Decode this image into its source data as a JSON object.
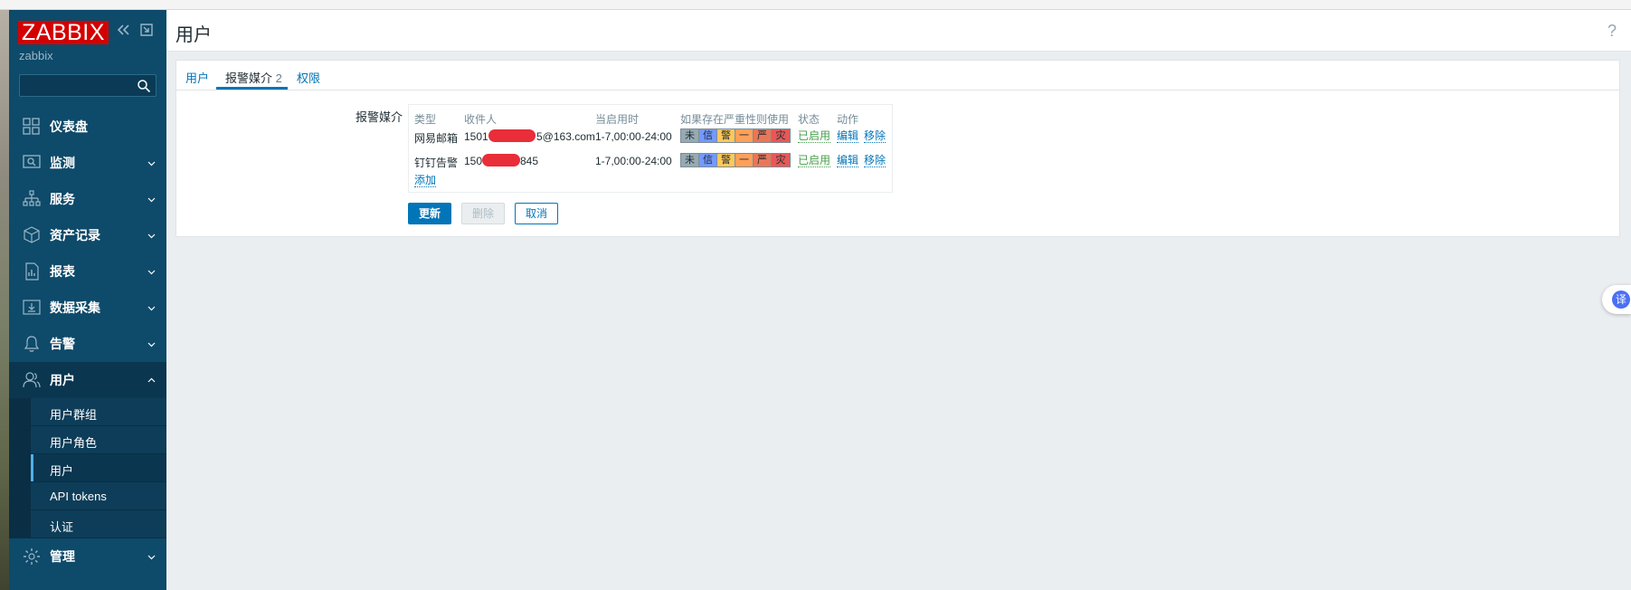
{
  "brand": {
    "logo_text": "ZABBIX",
    "server_name": "zabbix"
  },
  "sidebar": {
    "search_placeholder": "",
    "items": [
      {
        "label": "仪表盘",
        "icon": "dashboard-icon"
      },
      {
        "label": "监测",
        "icon": "monitoring-icon"
      },
      {
        "label": "服务",
        "icon": "services-icon"
      },
      {
        "label": "资产记录",
        "icon": "inventory-icon"
      },
      {
        "label": "报表",
        "icon": "reports-icon"
      },
      {
        "label": "数据采集",
        "icon": "data-collection-icon"
      },
      {
        "label": "告警",
        "icon": "alerts-bell-icon"
      },
      {
        "label": "用户",
        "icon": "users-icon"
      },
      {
        "label": "管理",
        "icon": "gear-icon"
      }
    ],
    "users_submenu": [
      {
        "label": "用户群组"
      },
      {
        "label": "用户角色"
      },
      {
        "label": "用户"
      },
      {
        "label": "API tokens"
      },
      {
        "label": "认证"
      }
    ]
  },
  "header": {
    "title": "用户",
    "help": "?"
  },
  "tabs": [
    {
      "label": "用户"
    },
    {
      "label": "报警媒介",
      "count": "2"
    },
    {
      "label": "权限"
    }
  ],
  "media": {
    "field_label": "报警媒介",
    "columns": [
      "类型",
      "收件人",
      "当启用时",
      "如果存在严重性则使用",
      "状态",
      "动作"
    ],
    "rows": [
      {
        "type": "网易邮箱",
        "recipient_prefix": "1501",
        "recipient_suffix": "5@163.com",
        "when_active": "1-7,00:00-24:00",
        "severity": [
          "未",
          "信",
          "警",
          "一",
          "严",
          "灾"
        ],
        "status": "已启用",
        "edit": "编辑",
        "remove": "移除"
      },
      {
        "type": "钉钉告警",
        "recipient_prefix": "150",
        "recipient_suffix": "845",
        "when_active": "1-7,00:00-24:00",
        "severity": [
          "未",
          "信",
          "警",
          "一",
          "严",
          "灾"
        ],
        "status": "已启用",
        "edit": "编辑",
        "remove": "移除"
      }
    ],
    "add_label": "添加"
  },
  "buttons": {
    "update": "更新",
    "delete": "删除",
    "cancel": "取消"
  },
  "severity_colors": [
    "#97aab3",
    "#7499ff",
    "#ffc859",
    "#ffa059",
    "#e97659",
    "#e45959"
  ],
  "colors": {
    "sidebar": "#0e4a6a",
    "brand_red": "#d40000",
    "link": "#0275b8",
    "enabled": "#429e47"
  },
  "translate_fab": "译"
}
